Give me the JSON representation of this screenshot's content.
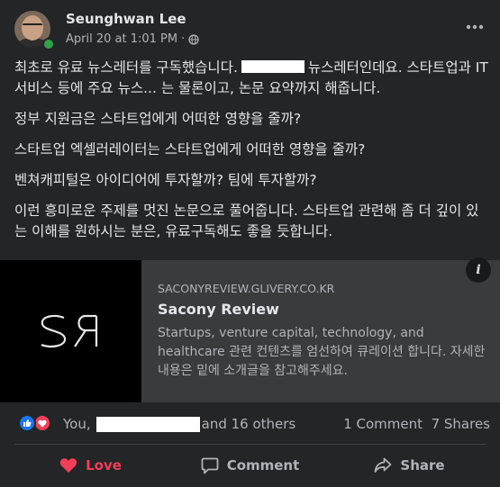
{
  "post": {
    "author": "Seunghwan Lee",
    "date": "April 20 at 1:01 PM",
    "separator": "·",
    "paragraphs": {
      "p1_start": "최초로 유료 뉴스레터를 구독했습니다.",
      "p1_end": "뉴스레터인데요. 스타트업과 IT 서비스 등에 주요 뉴스... 는 물론이고, 논문 요약까지 해줍니다.",
      "p2": "정부 지원금은 스타트업에게 어떠한 영향을 줄까?",
      "p3": "스타트업 엑셀러레이터는 스타트업에게 어떠한 영향을 줄까?",
      "p4": "벤쳐캐피털은 아이디어에 투자할까? 팀에 투자할까?",
      "p5": "이런 흥미로운 주제를 멋진 논문으로 풀어줍니다. 스타트업 관련해 좀 더 깊이 있는 이해를 원하시는 분은, 유료구독해도 좋을 듯합니다."
    }
  },
  "link_card": {
    "logo_text": "SR",
    "domain": "SACONYREVIEW.GLIVERY.CO.KR",
    "title": "Sacony Review",
    "description": "Startups, venture capital, technology, and healthcare 관련 컨텐츠를 엄선하여 큐레이션 합니다. 자세한 내용은 밑에 소개글을 참고해주세요.",
    "info_icon": "i"
  },
  "reactions": {
    "names_start": "You,",
    "names_end": "and 16 others",
    "comments": "1 Comment",
    "shares": "7 Shares"
  },
  "actions": {
    "love": "Love",
    "comment": "Comment",
    "share": "Share"
  },
  "colors": {
    "background": "#242526",
    "love_active": "#f33e58",
    "like_blue": "#1877f2",
    "online": "#31a24c"
  }
}
